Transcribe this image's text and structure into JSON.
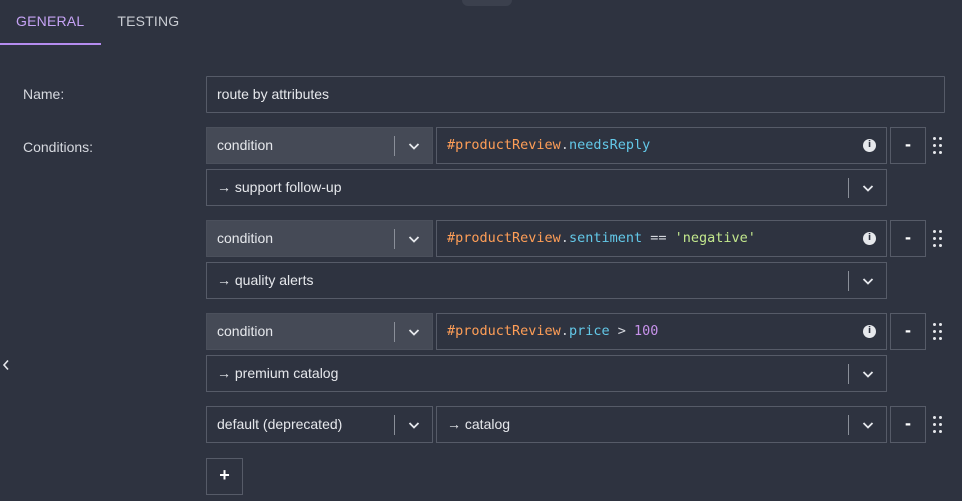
{
  "tabs": [
    {
      "label": "GENERAL",
      "active": true
    },
    {
      "label": "TESTING",
      "active": false
    }
  ],
  "form": {
    "name_label": "Name:",
    "name_value": "route by attributes",
    "conditions_label": "Conditions:"
  },
  "conditions": [
    {
      "type": "condition",
      "expression": {
        "var": "#productReview",
        "dot": ".",
        "prop": "needsReply"
      },
      "target": "→ support follow-up",
      "remove": "-"
    },
    {
      "type": "condition",
      "expression": {
        "var": "#productReview",
        "dot": ".",
        "prop": "sentiment",
        "op": " == ",
        "str": "'negative'"
      },
      "target": "→ quality alerts",
      "remove": "-"
    },
    {
      "type": "condition",
      "expression": {
        "var": "#productReview",
        "dot": ".",
        "prop": "price",
        "op": " > ",
        "num": "100"
      },
      "target": "→ premium catalog",
      "remove": "-"
    }
  ],
  "default_row": {
    "type": "default (deprecated)",
    "target": "→ catalog",
    "remove": "-"
  },
  "add_button": "+",
  "icons": {
    "chevron": "chevron-down-icon",
    "info": "info-icon",
    "drag": "drag-handle-icon",
    "collapse": "chevron-left-icon"
  },
  "colors": {
    "background": "#2e3340",
    "accent": "#b58cf0",
    "expr_var": "#ff9e57",
    "expr_prop": "#63c8e8",
    "expr_string": "#c3e88d",
    "expr_number": "#c792ea"
  }
}
